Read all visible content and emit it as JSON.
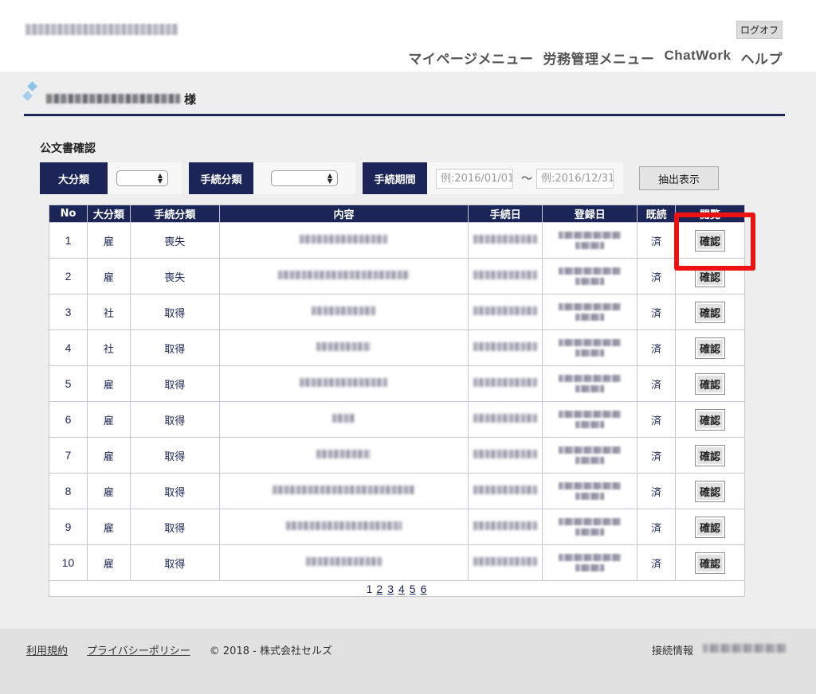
{
  "header": {
    "logout_label": "ログオフ",
    "nav": [
      "マイページメニュー",
      "労務管理メニュー",
      "ChatWork",
      "ヘルプ"
    ]
  },
  "user": {
    "suffix": "様"
  },
  "section_title": "公文書確認",
  "filters": {
    "category_label": "大分類",
    "procedure_type_label": "手続分類",
    "period_label": "手続期間",
    "date_from_placeholder": "例:2016/01/01",
    "date_to_placeholder": "例:2016/12/31",
    "tilde": "〜",
    "extract_button": "抽出表示"
  },
  "table": {
    "headers": [
      "No",
      "大分類",
      "手続分類",
      "内容",
      "手続日",
      "登録日",
      "既読",
      "閲覧"
    ],
    "rows": [
      {
        "no": "1",
        "category": "雇",
        "type": "喪失",
        "read": "済",
        "action": "確認"
      },
      {
        "no": "2",
        "category": "雇",
        "type": "喪失",
        "read": "済",
        "action": "確認"
      },
      {
        "no": "3",
        "category": "社",
        "type": "取得",
        "read": "済",
        "action": "確認"
      },
      {
        "no": "4",
        "category": "社",
        "type": "取得",
        "read": "済",
        "action": "確認"
      },
      {
        "no": "5",
        "category": "雇",
        "type": "取得",
        "read": "済",
        "action": "確認"
      },
      {
        "no": "6",
        "category": "雇",
        "type": "取得",
        "read": "済",
        "action": "確認"
      },
      {
        "no": "7",
        "category": "雇",
        "type": "取得",
        "read": "済",
        "action": "確認"
      },
      {
        "no": "8",
        "category": "雇",
        "type": "取得",
        "read": "済",
        "action": "確認"
      },
      {
        "no": "9",
        "category": "雇",
        "type": "取得",
        "read": "済",
        "action": "確認"
      },
      {
        "no": "10",
        "category": "雇",
        "type": "取得",
        "read": "済",
        "action": "確認"
      }
    ]
  },
  "pagination": {
    "current": "1",
    "pages": [
      "2",
      "3",
      "4",
      "5",
      "6"
    ]
  },
  "footer": {
    "terms": "利用規約",
    "privacy": "プライバシーポリシー",
    "copyright": "© 2018 - 株式会社セルズ",
    "connection_label": "接続情報"
  },
  "colors": {
    "navy": "#1b2557",
    "highlight": "#ee1111"
  }
}
